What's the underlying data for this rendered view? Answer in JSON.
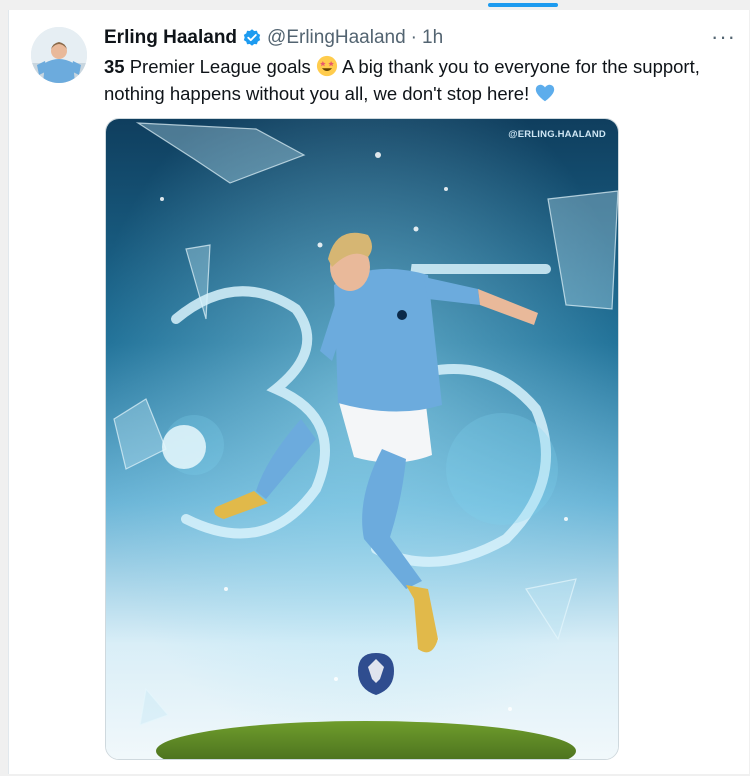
{
  "tweet": {
    "author_name": "Erling Haaland",
    "handle": "@ErlingHaaland",
    "separator": "·",
    "time": "1h",
    "more_label": "···",
    "text_bold": "35",
    "text_part1": " Premier League goals ",
    "text_part2": " A big thank you to everyone for the support, nothing happens without you all, we don't stop here! ",
    "emoji_1": "star-struck-emoji",
    "emoji_2": "blue-heart-emoji"
  },
  "media": {
    "watermark": "@ERLING.HAALAND"
  },
  "colors": {
    "link_blue": "#1d9bf0",
    "text": "#0f1419",
    "muted": "#536471"
  }
}
